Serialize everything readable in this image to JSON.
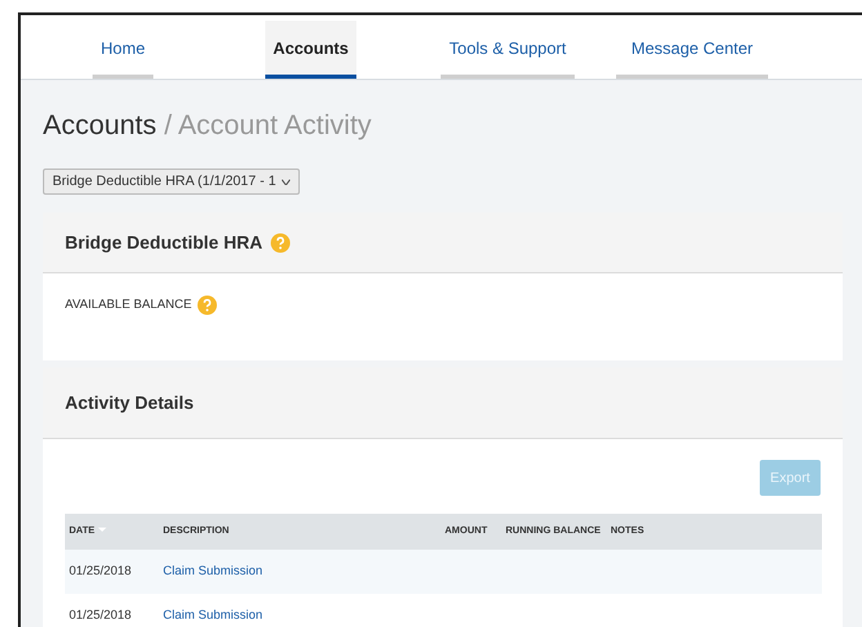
{
  "tabs": [
    {
      "label": "Home",
      "selected": false
    },
    {
      "label": "Accounts",
      "selected": true
    },
    {
      "label": "Tools & Support",
      "selected": false
    },
    {
      "label": "Message Center",
      "selected": false
    }
  ],
  "breadcrumb": {
    "current": "Accounts",
    "separator": "/",
    "page": "Account Activity"
  },
  "account_select": {
    "value": "Bridge Deductible HRA (1/1/2017 - 1"
  },
  "account_panel": {
    "title": "Bridge Deductible HRA",
    "balance_label": "AVAILABLE BALANCE"
  },
  "activity": {
    "title": "Activity Details",
    "export": {
      "label": "Export",
      "disabled": true
    },
    "columns": [
      {
        "label": "DATE",
        "sorted": true
      },
      {
        "label": "DESCRIPTION",
        "sorted": false
      },
      {
        "label": "AMOUNT",
        "sorted": false
      },
      {
        "label": "RUNNING BALANCE",
        "sorted": false
      },
      {
        "label": "NOTES",
        "sorted": false
      }
    ],
    "rows": [
      {
        "date": "01/25/2018",
        "description": "Claim Submission"
      },
      {
        "date": "01/25/2018",
        "description": "Claim Submission"
      }
    ]
  }
}
